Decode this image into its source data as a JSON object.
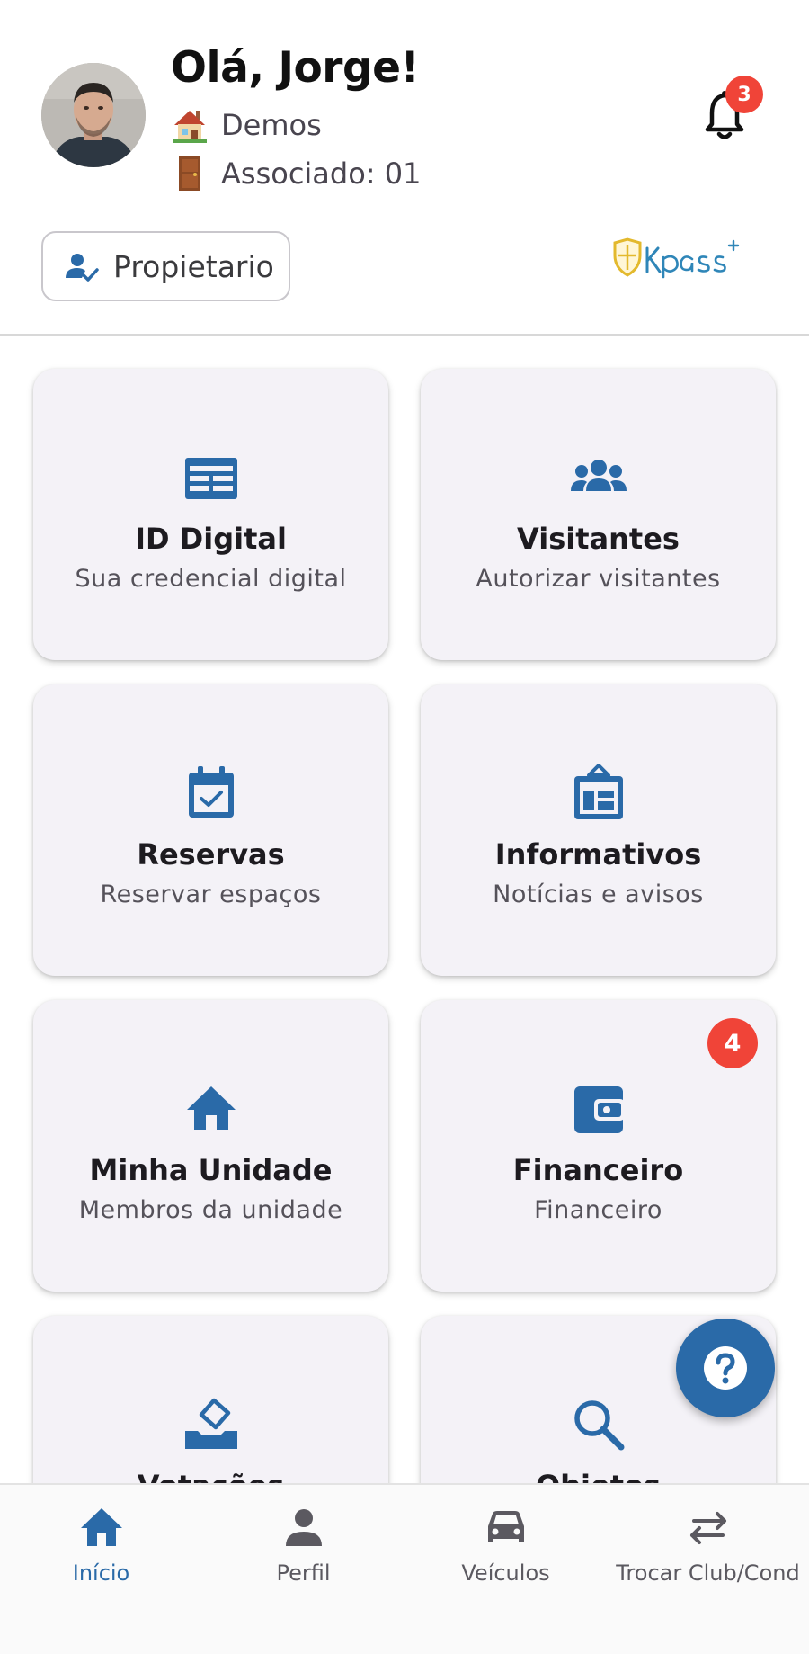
{
  "colors": {
    "primary": "#2a6aa8",
    "badge": "#f04438",
    "card_bg": "#f4f2f7",
    "logo_gold": "#e3b92d",
    "logo_blue": "#2f86b8"
  },
  "header": {
    "avatar_icon": "user-photo",
    "greeting": "Olá, Jorge!",
    "property_icon": "house-emoji",
    "property": "Demos",
    "unit_icon": "door-emoji",
    "unit": "Associado: 01",
    "notification_count": "3",
    "role_chip_label": "Propietario",
    "logo_text": "Kpass",
    "logo_superscript": "+"
  },
  "cards": [
    {
      "title": "ID Digital",
      "subtitle": "Sua credencial digital",
      "icon": "id-card-icon"
    },
    {
      "title": "Visitantes",
      "subtitle": "Autorizar visitantes",
      "icon": "group-icon"
    },
    {
      "title": "Reservas",
      "subtitle": "Reservar espaços",
      "icon": "calendar-check-icon"
    },
    {
      "title": "Informativos",
      "subtitle": "Notícias e avisos",
      "icon": "news-board-icon"
    },
    {
      "title": "Minha Unidade",
      "subtitle": "Membros da unidade",
      "icon": "home-icon"
    },
    {
      "title": "Financeiro",
      "subtitle": "Financeiro",
      "icon": "wallet-icon",
      "badge": "4"
    },
    {
      "title": "Votações",
      "subtitle": "",
      "icon": "ballot-icon"
    },
    {
      "title": "Objetos",
      "subtitle": "",
      "icon": "search-icon"
    }
  ],
  "fab": {
    "icon": "help-icon"
  },
  "bottom_nav": [
    {
      "label": "Início",
      "icon": "home-icon",
      "active": true
    },
    {
      "label": "Perfil",
      "icon": "person-icon",
      "active": false
    },
    {
      "label": "Veículos",
      "icon": "car-icon",
      "active": false
    },
    {
      "label": "Trocar Club/Cond",
      "icon": "swap-icon",
      "active": false
    }
  ]
}
